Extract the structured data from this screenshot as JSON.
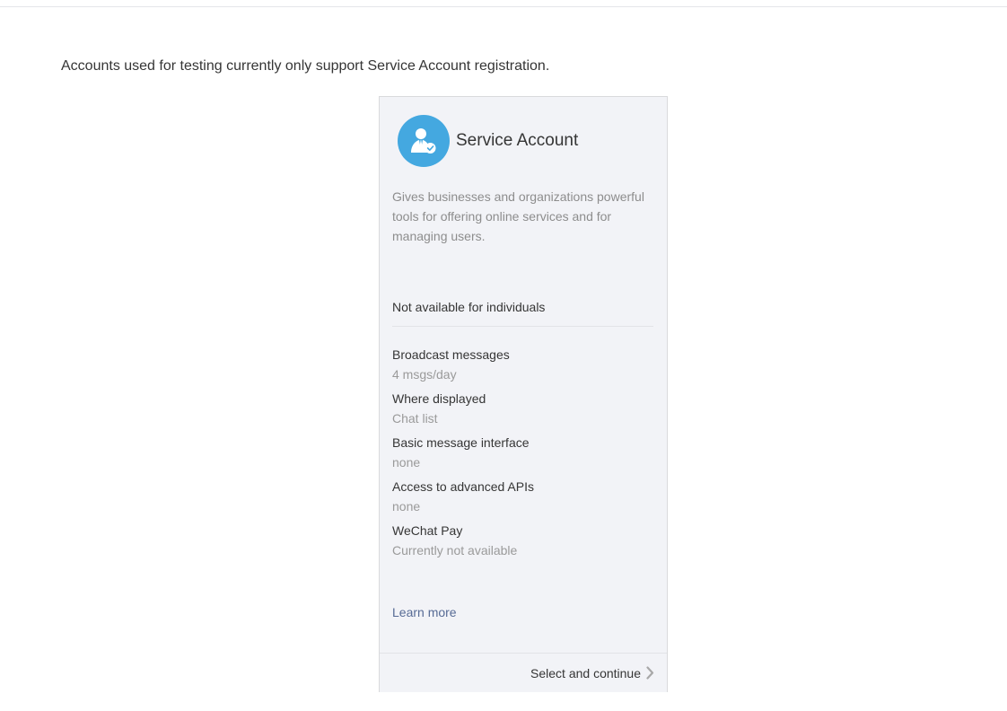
{
  "notice": "Accounts used for testing currently only support Service Account registration.",
  "card": {
    "title": "Service Account",
    "icon": "service-account-icon",
    "accent_color": "#44a8e0",
    "description": "Gives businesses and organizations powerful tools for offering online services and for managing users.",
    "availability": "Not available for individuals",
    "features": [
      {
        "label": "Broadcast messages",
        "value": "4 msgs/day"
      },
      {
        "label": "Where displayed",
        "value": "Chat list"
      },
      {
        "label": "Basic message interface",
        "value": "none"
      },
      {
        "label": "Access to advanced APIs",
        "value": "none"
      },
      {
        "label": "WeChat Pay",
        "value": "Currently not available"
      }
    ],
    "learn_more": "Learn more",
    "link_color": "#576b95",
    "continue_label": "Select and continue",
    "continue_icon": "chevron-right-icon"
  }
}
